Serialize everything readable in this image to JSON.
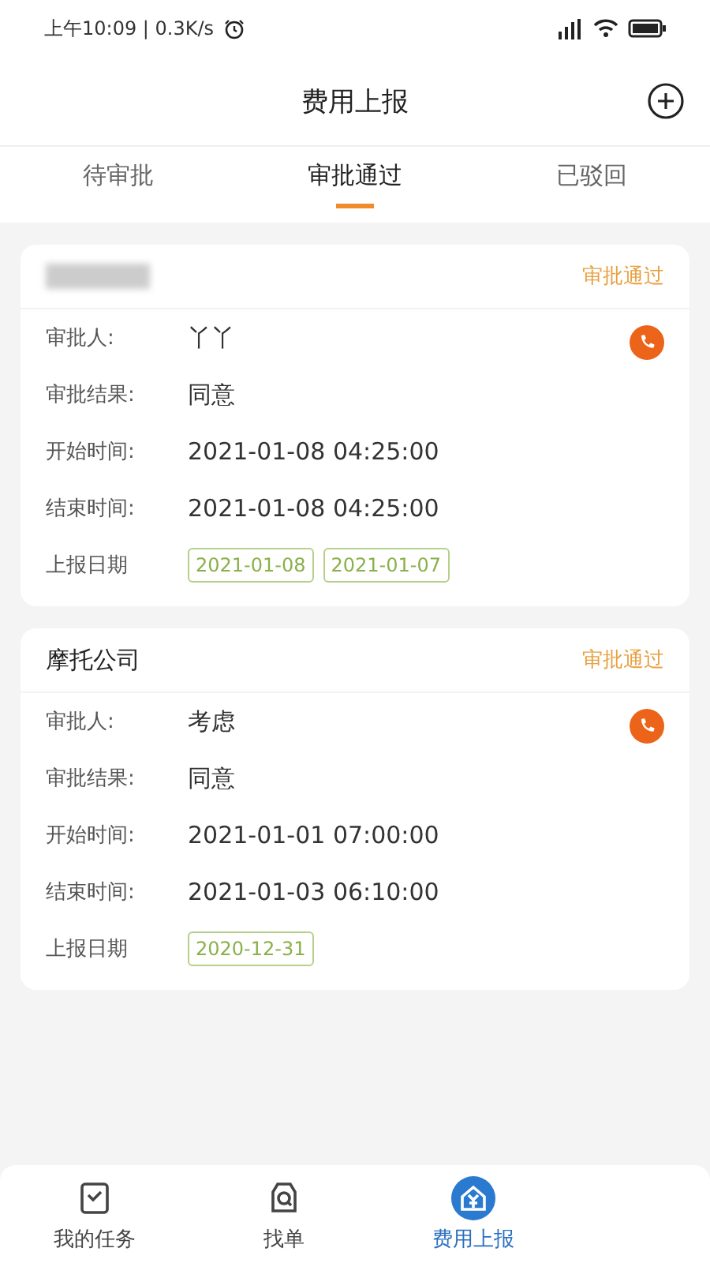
{
  "status_bar": {
    "time": "上午10:09 | 0.3K/s"
  },
  "header": {
    "title": "费用上报"
  },
  "tabs": [
    {
      "label": "待审批",
      "selected": false
    },
    {
      "label": "审批通过",
      "selected": true
    },
    {
      "label": "已驳回",
      "selected": false
    }
  ],
  "cards": [
    {
      "redacted": true,
      "status": "审批通过",
      "fields": [
        {
          "label": "审批人:",
          "value": "丫丫"
        },
        {
          "label": "审批结果:",
          "value": "同意"
        },
        {
          "label": "开始时间:",
          "value": "2021-01-08 04:25:00"
        },
        {
          "label": "结束时间:",
          "value": "2021-01-08 04:25:00"
        }
      ],
      "dates_label": "上报日期",
      "dates": [
        "2021-01-08",
        "2021-01-07"
      ]
    },
    {
      "title": "摩托公司",
      "redacted": false,
      "status": "审批通过",
      "fields": [
        {
          "label": "审批人:",
          "value": "考虑"
        },
        {
          "label": "审批结果:",
          "value": "同意"
        },
        {
          "label": "开始时间:",
          "value": "2021-01-01 07:00:00"
        },
        {
          "label": "结束时间:",
          "value": "2021-01-03 06:10:00"
        }
      ],
      "dates_label": "上报日期",
      "dates": [
        "2020-12-31"
      ]
    }
  ],
  "nav": [
    {
      "label": "我的任务",
      "kind": "tasks",
      "selected": false
    },
    {
      "label": "找单",
      "kind": "search",
      "selected": false
    },
    {
      "label": "费用上报",
      "kind": "expense",
      "selected": true
    }
  ]
}
